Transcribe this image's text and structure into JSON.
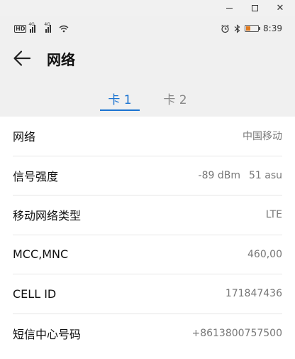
{
  "window": {
    "controls": [
      "minimize",
      "maximize",
      "close"
    ]
  },
  "status_bar": {
    "hd_label": "HD",
    "sim1_net": "4G",
    "sim2_net": "4G",
    "battery_level": 0.35,
    "time": "8:39",
    "colors": {
      "battery": "#e07a20"
    }
  },
  "header": {
    "title": "网络"
  },
  "tabs": [
    {
      "label": "卡 1",
      "active": true
    },
    {
      "label": "卡 2",
      "active": false
    }
  ],
  "rows": [
    {
      "label": "网络",
      "value": "中国移动"
    },
    {
      "label": "信号强度",
      "value": "-89 dBm",
      "value2": "51 asu"
    },
    {
      "label": "移动网络类型",
      "value": "LTE"
    },
    {
      "label": "MCC,MNC",
      "value": "460,00"
    },
    {
      "label": "CELL ID",
      "value": "171847436"
    },
    {
      "label": "短信中心号码",
      "value": "+8613800757500"
    }
  ],
  "colors": {
    "accent": "#1a73d1"
  }
}
